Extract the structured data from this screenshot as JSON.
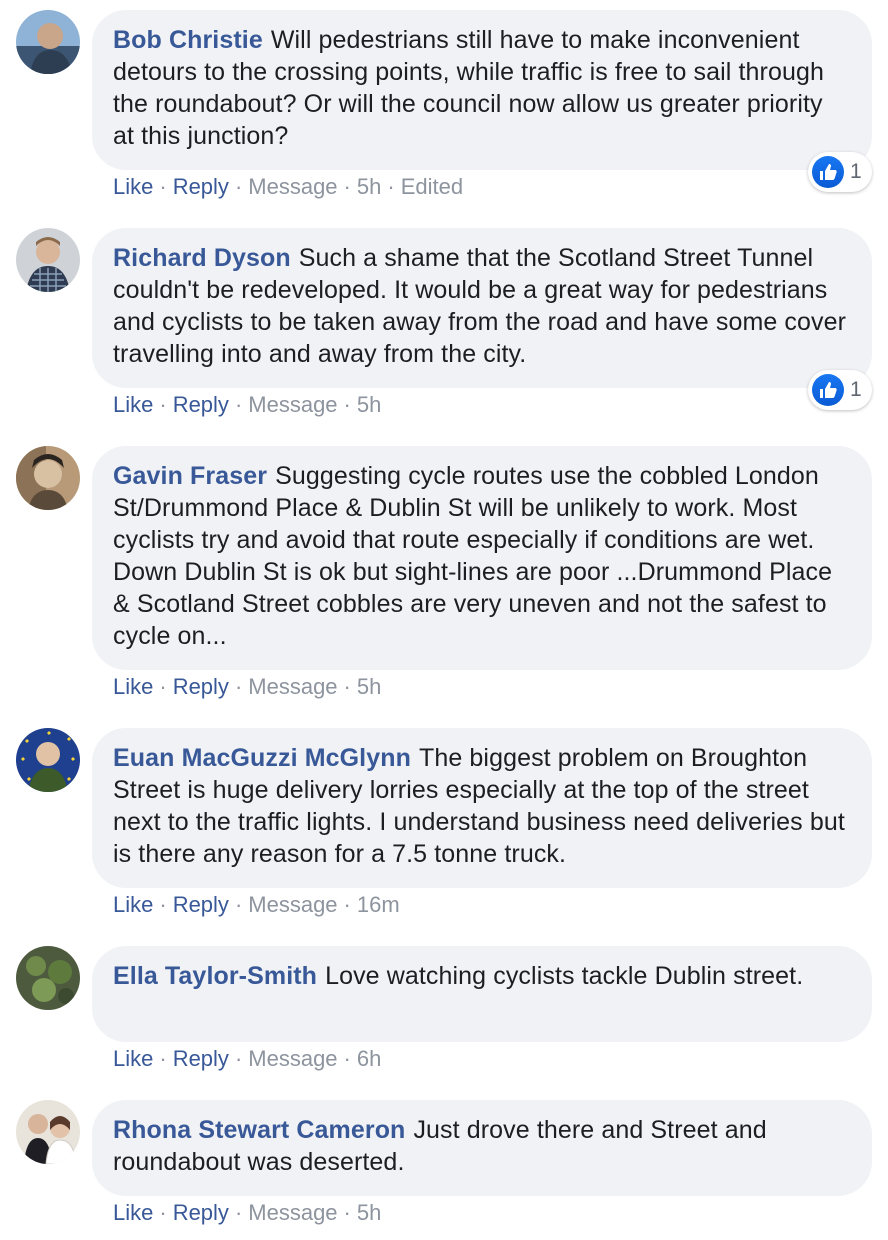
{
  "comments": [
    {
      "author": "Bob Christie",
      "text": "Will pedestrians still have to make inconvenient detours to the crossing points, while traffic is free to sail through the roundabout? Or will the council now allow us greater priority at this junction?",
      "like": "Like",
      "reply": "Reply",
      "message": "Message",
      "time": "5h",
      "edited": "Edited",
      "reactions": "1"
    },
    {
      "author": "Richard Dyson",
      "text": "Such a shame that the Scotland Street Tunnel couldn't be redeveloped. It would be a great way for pedestrians and cyclists to be taken away from the road and have some cover travelling into and away from the city.",
      "like": "Like",
      "reply": "Reply",
      "message": "Message",
      "time": "5h",
      "reactions": "1"
    },
    {
      "author": "Gavin Fraser",
      "text": "Suggesting cycle routes use the cobbled London St/Drummond Place & Dublin St will be unlikely to work. Most cyclists try and avoid that route especially if conditions are wet. Down Dublin St is ok but sight-lines are poor ...Drummond Place & Scotland Street cobbles are very uneven and not the safest to cycle on...",
      "like": "Like",
      "reply": "Reply",
      "message": "Message",
      "time": "5h"
    },
    {
      "author": "Euan MacGuzzi McGlynn",
      "text": "The biggest problem on Broughton Street is huge delivery lorries especially at the top of the street next to the traffic lights. I understand business need deliveries but is there any reason for a 7.5 tonne truck.",
      "like": "Like",
      "reply": "Reply",
      "message": "Message",
      "time": "16m"
    },
    {
      "author": "Ella Taylor-Smith",
      "text": "Love watching cyclists tackle Dublin street.",
      "like": "Like",
      "reply": "Reply",
      "message": "Message",
      "time": "6h"
    },
    {
      "author": "Rhona Stewart Cameron",
      "text": "Just drove there and Street and roundabout was deserted.",
      "like": "Like",
      "reply": "Reply",
      "message": "Message",
      "time": "5h"
    }
  ],
  "icons": {
    "reaction": "like-thumbs-up-icon"
  },
  "colors": {
    "link": "#385898",
    "bubble": "#f0f2f5",
    "like": "#1877f2"
  }
}
